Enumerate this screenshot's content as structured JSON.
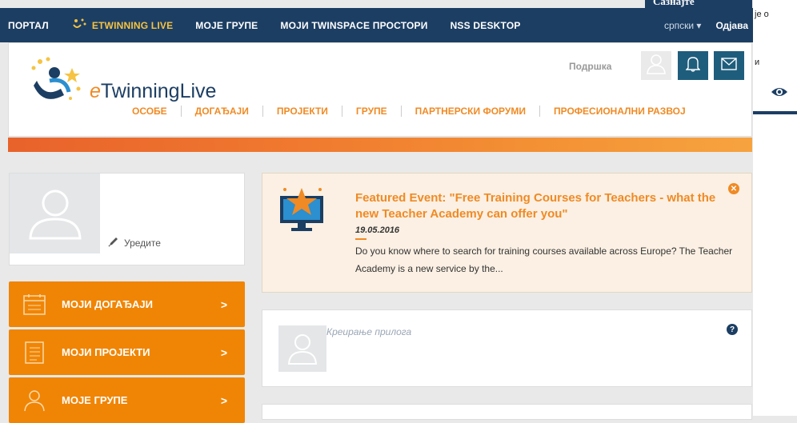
{
  "topbar": {
    "items": [
      "ПОРТАЛ",
      "ETWINNING LIVE",
      "МОЈЕ ГРУПЕ",
      "МОЈИ TWINSPACE ПРОСТОРИ",
      "NSS DESKTOP"
    ],
    "language": "српски ▾",
    "logout": "Одјава"
  },
  "popup": {
    "heading": "Сазнајте",
    "text1": "је о",
    "text2": "и"
  },
  "header": {
    "logo_e": "e",
    "logo_rest": "TwinningLive",
    "support": "Подршка",
    "nav": [
      "ОСОБЕ",
      "ДОГАЂАЈИ",
      "ПРОЈЕКТИ",
      "ГРУПЕ",
      "ПАРТНЕРСКИ ФОРУМИ",
      "ПРОФЕСИОНАЛНИ РАЗВОЈ"
    ]
  },
  "profile": {
    "edit": "Уредите"
  },
  "sidebar": {
    "buttons": [
      "МОЈИ ДОГАЂАЈИ",
      "МОЈИ ПРОЈЕКТИ",
      "МОЈЕ ГРУПЕ"
    ],
    "arrow": ">"
  },
  "featured": {
    "title": "Featured Event: \"Free Training Courses for Teachers - what the new Teacher Academy can offer you\"",
    "date": "19.05.2016",
    "body": "Do you know where to search for training courses available across Europe? The Teacher Academy is a new service by the..."
  },
  "post": {
    "placeholder": "Креирање прилога",
    "help": "?"
  },
  "colors": {
    "navy": "#1c3e63",
    "orange": "#f08505",
    "accent_yellow": "#f6c342"
  }
}
